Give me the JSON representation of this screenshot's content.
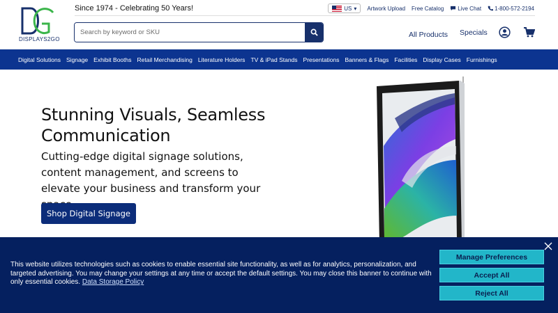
{
  "brand": {
    "logo_text": "DISPLAYS2GO",
    "tagline": "Since 1974 - Celebrating 50 Years!"
  },
  "top_links": {
    "country": "US",
    "artwork_upload": "Artwork Upload",
    "free_catalog": "Free Catalog",
    "live_chat": "Live Chat",
    "phone": "1-800-572-2194"
  },
  "search": {
    "placeholder": "Search by keyword or SKU"
  },
  "header_nav": {
    "all_products": "All Products",
    "specials": "Specials"
  },
  "category_nav": [
    "Digital Solutions",
    "Signage",
    "Exhibit Booths",
    "Retail Merchandising",
    "Literature Holders",
    "TV & iPad Stands",
    "Presentations",
    "Banners & Flags",
    "Facilities",
    "Display Cases",
    "Furnishings"
  ],
  "hero": {
    "title": "Stunning Visuals, Seamless Communication",
    "subtitle": "Cutting-edge digital signage solutions, content management, and screens to elevate your business and transform your space",
    "cta": "Shop Digital Signage"
  },
  "cookie_banner": {
    "text": "This website utilizes technologies such as cookies to enable essential site functionality, as well as for analytics, personalization, and targeted advertising. You may change your settings at any time or accept the default settings. You may close this banner to continue with only essential cookies.",
    "policy_link": "Data Storage Policy",
    "manage": "Manage Preferences",
    "accept": "Accept All",
    "reject": "Reject All"
  },
  "colors": {
    "brand_navy": "#17306b",
    "nav_blue": "#0c3490",
    "banner_navy": "#05205f",
    "teal": "#22b6c9",
    "logo_green": "#3bb54a"
  }
}
